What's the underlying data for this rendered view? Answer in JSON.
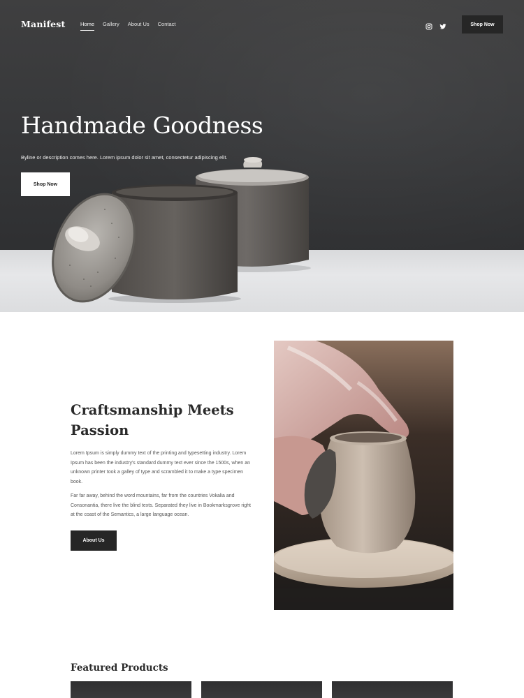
{
  "brand": {
    "logo": "Manifest"
  },
  "nav": {
    "links": [
      {
        "label": "Home",
        "active": true
      },
      {
        "label": "Gallery",
        "active": false
      },
      {
        "label": "About Us",
        "active": false
      },
      {
        "label": "Contact",
        "active": false
      }
    ],
    "social_icons": [
      "instagram-icon",
      "twitter-icon"
    ],
    "cta_label": "Shop Now"
  },
  "hero": {
    "title": "Handmade Goodness",
    "byline": "Byline or description comes here. Lorem ipsum dolor sit amet, consectetur adipiscing elit.",
    "cta_label": "Shop Now"
  },
  "about": {
    "title_line1": "Craftsmanship Meets",
    "title_line2": "Passion",
    "paragraph1": "Lorem Ipsum is simply dummy text of the printing and typesetting industry. Lorem Ipsum has been the industry's standard dummy text ever since the 1500s, when an unknown printer took a galley of type and scrambled it to make a type specimen book.",
    "paragraph2": "Far far away, behind the word mountains, far from the countries Vokalia and Consonantia, there live the blind texts. Separated they live in Bookmarksgrove right at the coast of the Semantics, a large language ocean.",
    "cta_label": "About Us"
  },
  "featured": {
    "title": "Featured Products"
  },
  "colors": {
    "dark_button": "#262626",
    "hero_background": "#37383a",
    "text_heading": "#2a2a2a",
    "text_body": "#555555"
  }
}
